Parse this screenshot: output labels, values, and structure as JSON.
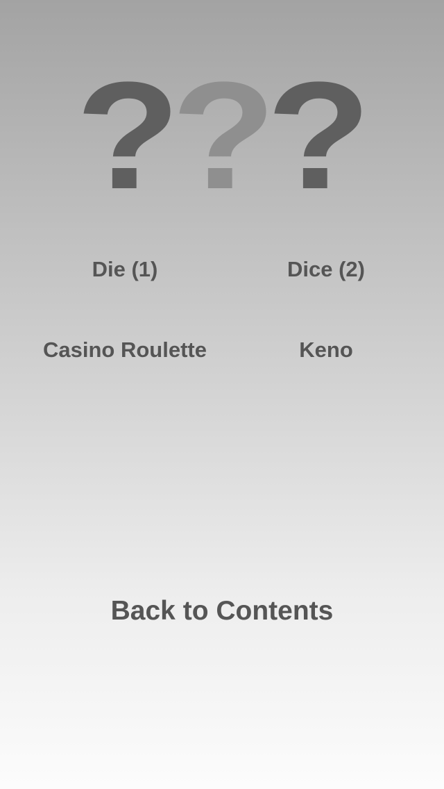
{
  "logo": {
    "glyphs": [
      "?",
      "?",
      "?"
    ],
    "colors": [
      "#5f5f5f",
      "#8f8f8f",
      "#5f5f5f"
    ]
  },
  "menu": {
    "die": "Die (1)",
    "dice": "Dice (2)",
    "roulette": "Casino Roulette",
    "keno": "Keno"
  },
  "footer": {
    "back": "Back to Contents"
  },
  "colors": {
    "text": "#555555",
    "gradient_top": "#a3a3a3",
    "gradient_bottom": "#fcfcfc"
  }
}
